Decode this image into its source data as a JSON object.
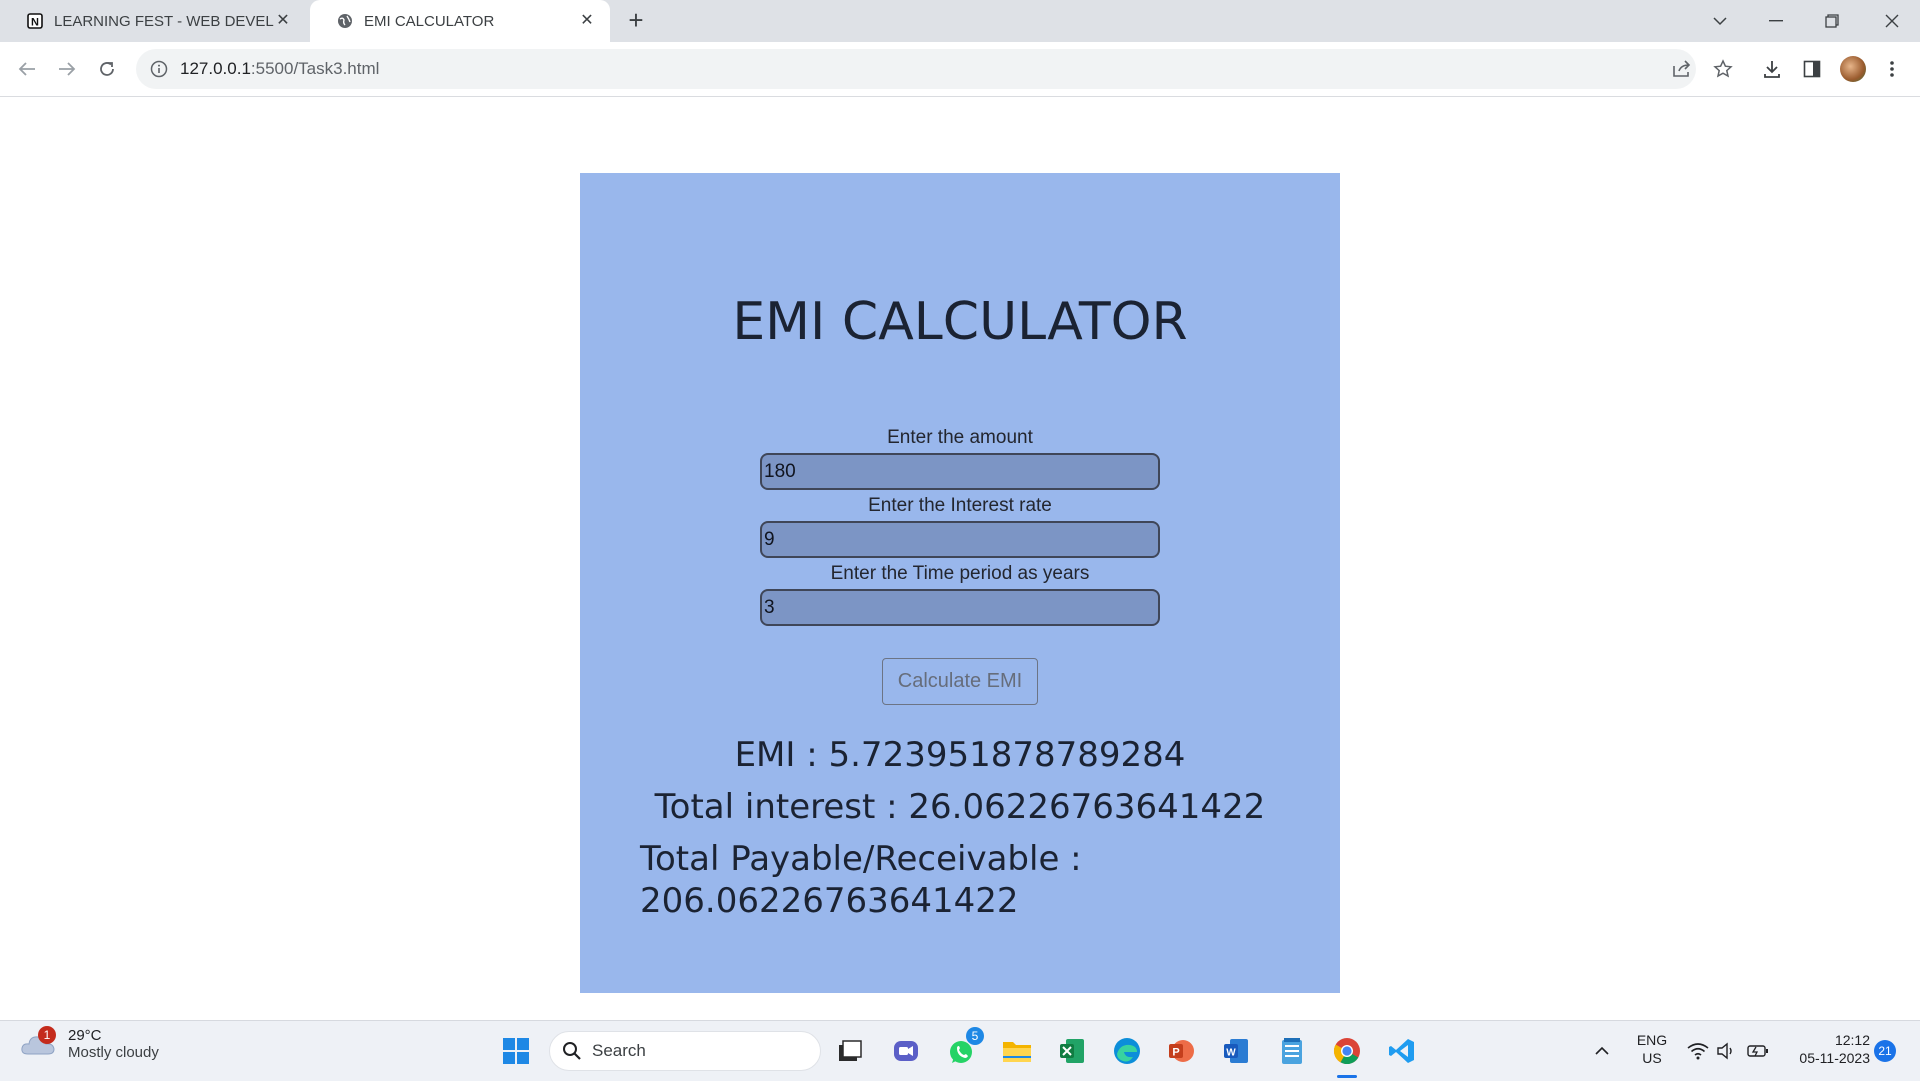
{
  "browser": {
    "tabs": [
      {
        "title": "LEARNING FEST - WEB DEVELOP",
        "favicon": "notion-icon",
        "active": false
      },
      {
        "title": "EMI CALCULATOR",
        "favicon": "globe-icon",
        "active": true
      }
    ],
    "address": {
      "host": "127.0.0.1",
      "path": ":5500/Task3.html"
    }
  },
  "page": {
    "title": "EMI CALCULATOR",
    "fields": [
      {
        "label": "Enter the amount",
        "value": "180"
      },
      {
        "label": "Enter the Interest rate",
        "value": "9"
      },
      {
        "label": "Enter the Time period as years",
        "value": "3"
      }
    ],
    "button_label": "Calculate EMI",
    "results": {
      "emi": "EMI : 5.723951878789284",
      "total_interest": "Total interest : 26.06226763641422",
      "total_payable_line1": "Total Payable/Receivable :",
      "total_payable_line2": "206.06226763641422"
    },
    "colors": {
      "card_bg": "#99b7ec",
      "input_bg": "#7c95c5"
    }
  },
  "taskbar": {
    "weather": {
      "temp": "29°C",
      "desc": "Mostly cloudy",
      "badge": "1"
    },
    "search_placeholder": "Search",
    "whatsapp_badge": "5",
    "lang_line1": "ENG",
    "lang_line2": "US",
    "time": "12:12",
    "date": "05-11-2023",
    "notification_count": "21"
  }
}
